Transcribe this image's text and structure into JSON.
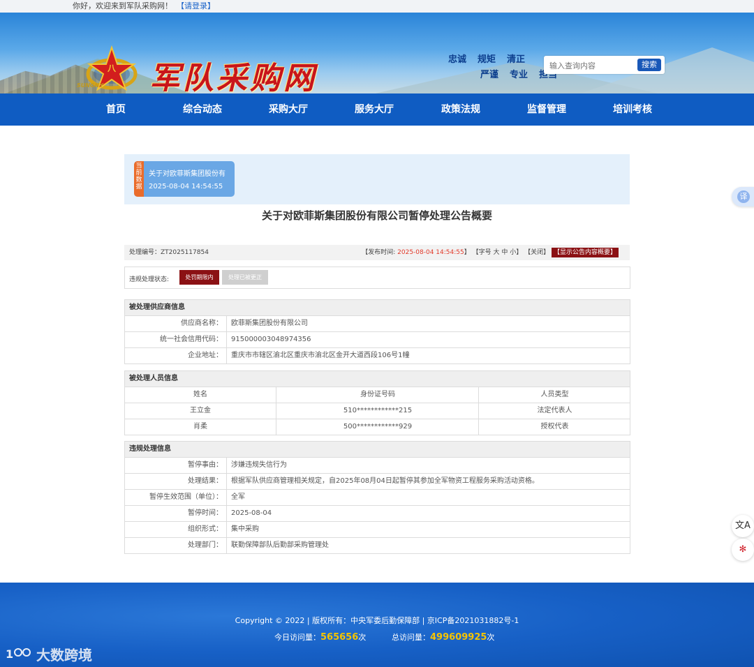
{
  "topbar": {
    "greeting": "你好，欢迎来到军队采购网！",
    "login": "【请登录】"
  },
  "header": {
    "site_title": "军队采购网",
    "emblem_caption": "SUNGNY",
    "slogans": [
      "忠诚",
      "规矩",
      "清正",
      "严谨",
      "专业",
      "担当"
    ],
    "search_placeholder": "输入查询内容",
    "search_button": "搜索"
  },
  "nav": [
    "首页",
    "综合动态",
    "采购大厅",
    "服务大厅",
    "政策法规",
    "监督管理",
    "培训考核"
  ],
  "current_card": {
    "tag": "当前数据",
    "title": "关于对欧菲斯集团股份有",
    "datetime": "2025-08-04 14:54:55"
  },
  "notice": {
    "title": "关于对欧菲斯集团股份有限公司暂停处理公告概要",
    "code_label": "处理编号：",
    "code": "ZT2025117854",
    "pub_prefix": "【发布时间: ",
    "pub_time": "2025-08-04 14:54:55",
    "pub_suffix": "】",
    "font_ctrl": "【字号 大 中 小】",
    "close": "【关闭】",
    "show_btn": "【显示公告内容概要】"
  },
  "status": {
    "label": "违规处理状态:",
    "active": "处罚期限内",
    "inactive": "处理已被更正"
  },
  "supplier": {
    "head": "被处理供应商信息",
    "rows": [
      {
        "k": "供应商名称：",
        "v": "欧菲斯集团股份有限公司"
      },
      {
        "k": "统一社会信用代码：",
        "v": "915000003048974356"
      },
      {
        "k": "企业地址：",
        "v": "重庆市市辖区渝北区重庆市渝北区金开大道西段106号1幢"
      }
    ]
  },
  "persons": {
    "head": "被处理人员信息",
    "cols": [
      "姓名",
      "身份证号码",
      "人员类型"
    ],
    "rows": [
      [
        "王立金",
        "510************215",
        "法定代表人"
      ],
      [
        "肖柔",
        "500************929",
        "授权代表"
      ]
    ]
  },
  "violation": {
    "head": "违规处理信息",
    "rows": [
      {
        "k": "暂停事由：",
        "v": "涉嫌违规失信行为"
      },
      {
        "k": "处理结果：",
        "v": "根据军队供应商管理相关规定，自2025年08月04日起暂停其参加全军物资工程服务采购活动资格。"
      },
      {
        "k": "暂停生效范围（单位）：",
        "v": "全军"
      },
      {
        "k": "暂停时间：",
        "v": "2025-08-04"
      },
      {
        "k": "组织形式：",
        "v": "集中采购"
      },
      {
        "k": "处理部门：",
        "v": "联勤保障部队后勤部采购管理处"
      }
    ]
  },
  "footer": {
    "copyright": "Copyright © 2022 | 版权所有：中央军委后勤保障部 | 京ICP备2021031882号-1",
    "today_label": "今日访问量：",
    "today_value": "565656",
    "total_label": "总访问量：",
    "total_value": "499609925",
    "unit": "次",
    "watermark": "大数跨境"
  },
  "floating": {
    "translate": "译",
    "lang": "文A",
    "app": "✻"
  },
  "colors": {
    "nav": "#0f5cc2",
    "accent_red": "#8b1114",
    "footer": "#1760c6",
    "highlight": "#f5c400"
  }
}
